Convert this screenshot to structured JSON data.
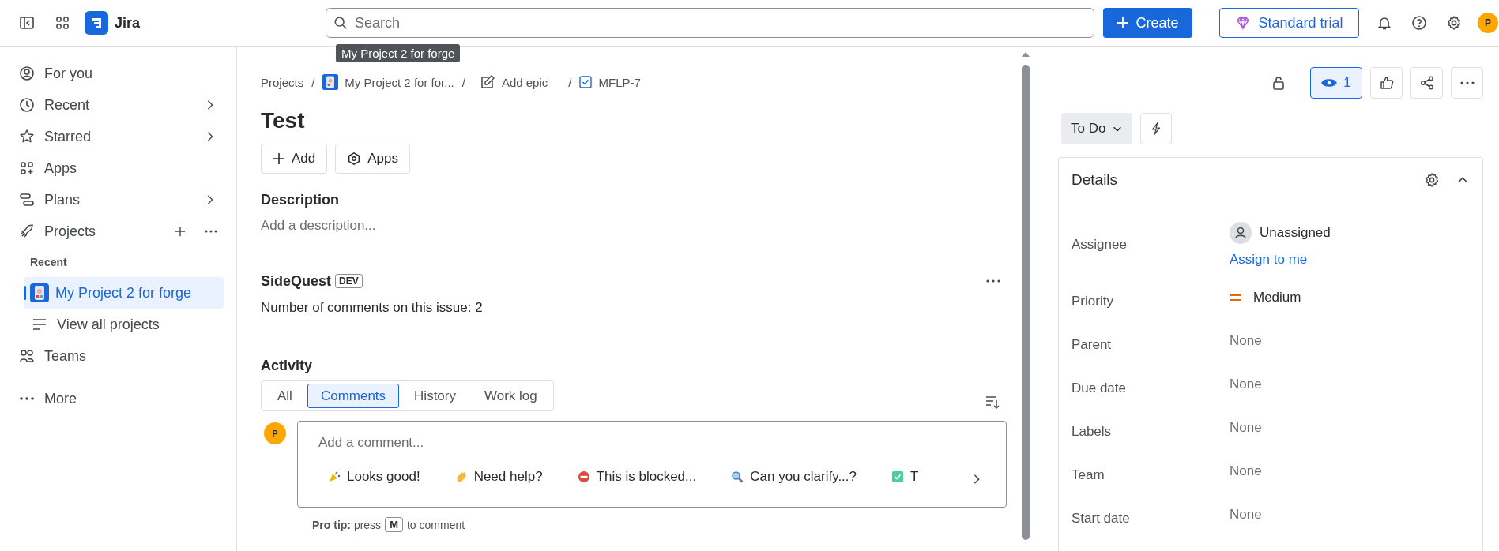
{
  "header": {
    "product": "Jira",
    "search": {
      "placeholder": "Search"
    },
    "create": "Create",
    "trial": "Standard trial",
    "avatar": "P"
  },
  "tooltip": "My Project 2 for forge",
  "sidebar": {
    "items": [
      {
        "kind": "nav",
        "label": "For you",
        "selected": false,
        "expandable": false
      },
      {
        "kind": "nav",
        "label": "Recent",
        "selected": false,
        "expandable": true
      },
      {
        "kind": "nav",
        "label": "Starred",
        "selected": false,
        "expandable": true
      },
      {
        "kind": "nav",
        "label": "Apps",
        "selected": false,
        "expandable": false
      },
      {
        "kind": "nav",
        "label": "Plans",
        "selected": false,
        "expandable": true
      },
      {
        "kind": "nav",
        "label": "Projects",
        "selected": false,
        "expandable": false,
        "actions": true,
        "children": [
          {
            "kind": "heading",
            "label": "Recent"
          },
          {
            "kind": "project",
            "label": "My Project 2 for forge",
            "selected": true
          },
          {
            "kind": "link",
            "label": "View all projects",
            "selected": false
          }
        ]
      },
      {
        "kind": "nav",
        "label": "Teams",
        "selected": false,
        "expandable": false
      },
      {
        "kind": "more",
        "label": "More",
        "selected": false,
        "expandable": false
      }
    ]
  },
  "issue": {
    "breadcrumb": [
      {
        "kind": "text",
        "label": "Projects"
      },
      {
        "kind": "sep",
        "label": "/"
      },
      {
        "kind": "project",
        "label": "My Project 2 for for..."
      },
      {
        "kind": "sep",
        "label": "/"
      },
      {
        "kind": "epic",
        "label": "Add epic"
      },
      {
        "kind": "sep",
        "label": "/"
      },
      {
        "kind": "issue",
        "label": "MFLP-7"
      }
    ],
    "title": "Test",
    "buttons": [
      "Add",
      "Apps"
    ],
    "description": {
      "heading": "Description",
      "placeholder": "Add a description..."
    },
    "sidequest": {
      "title": "SideQuest",
      "badge": "DEV",
      "text": "Number of comments on this issue: 2"
    },
    "activity": {
      "heading": "Activity",
      "tabs": [
        {
          "label": "All",
          "selected": false
        },
        {
          "label": "Comments",
          "selected": true
        },
        {
          "label": "History",
          "selected": false
        },
        {
          "label": "Work log",
          "selected": false
        }
      ],
      "comment": {
        "avatar": "P",
        "placeholder": "Add a comment...",
        "suggestions": [
          "Looks good!",
          "Need help?",
          "This is blocked...",
          "Can you clarify...?",
          "T"
        ]
      },
      "pro_tip": {
        "lead": "**Pro tip:** press",
        "key": "M",
        "tail": "to comment"
      }
    }
  },
  "panel": {
    "watchers": {
      "count": "1",
      "watching": true
    },
    "status": "To Do",
    "details": {
      "heading": "Details",
      "fields": [
        {
          "kind": "user",
          "label": "Assignee",
          "value": "Unassigned",
          "link": "Assign to me"
        },
        {
          "kind": "priority",
          "label": "Priority",
          "value": "Medium"
        },
        {
          "kind": "empty",
          "label": "Parent",
          "value": "None"
        },
        {
          "kind": "empty",
          "label": "Due date",
          "value": "None"
        },
        {
          "kind": "empty",
          "label": "Labels",
          "value": "None"
        },
        {
          "kind": "empty",
          "label": "Team",
          "value": "None"
        },
        {
          "kind": "empty",
          "label": "Start date",
          "value": "None"
        }
      ]
    }
  }
}
